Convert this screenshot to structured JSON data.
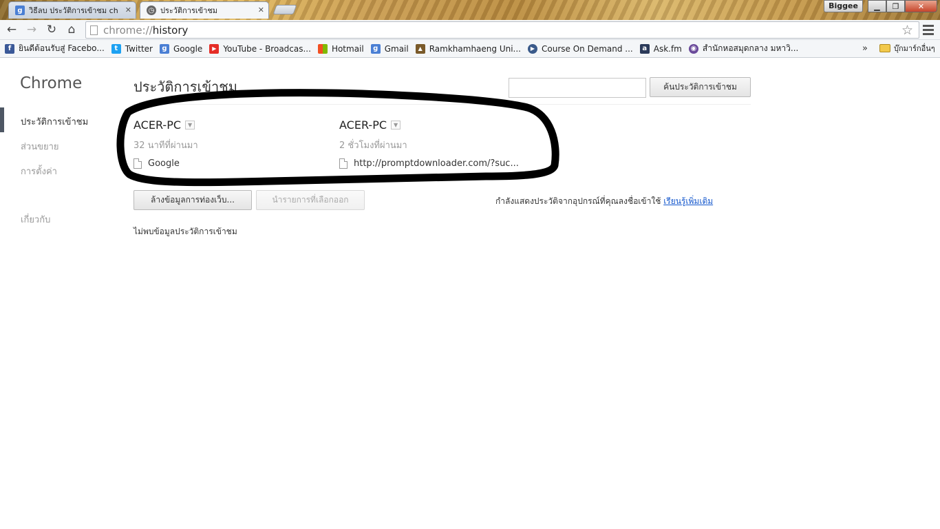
{
  "tabs": [
    {
      "label": "วิธีลบ ประวัติการเข้าชม chrom",
      "icon": "google-search-icon",
      "color": "#4a7fd4"
    },
    {
      "label": "ประวัติการเข้าชม",
      "icon": "history-clock-icon",
      "color": "#555555"
    }
  ],
  "profile_name": "Biggee",
  "toolbar": {
    "url_scheme": "chrome://",
    "url_path": "history"
  },
  "bookmarks": [
    {
      "label": "ยินดีต้อนรับสู่ Facebo...",
      "icon": "facebook-icon",
      "color": "#3b5998",
      "glyph": "f"
    },
    {
      "label": "Twitter",
      "icon": "twitter-icon",
      "color": "#1da1f2",
      "glyph": "t"
    },
    {
      "label": "Google",
      "icon": "google-icon",
      "color": "#4a7fd4",
      "glyph": "g"
    },
    {
      "label": "YouTube - Broadcas...",
      "icon": "youtube-icon",
      "color": "#e52d27",
      "glyph": "▶"
    },
    {
      "label": "Hotmail",
      "icon": "windows-icon",
      "color": "#f25022",
      "glyph": "▦"
    },
    {
      "label": "Gmail",
      "icon": "google-icon",
      "color": "#4a7fd4",
      "glyph": "g"
    },
    {
      "label": "Ramkhamhaeng Uni...",
      "icon": "university-icon",
      "color": "#7a5a2a",
      "glyph": "▲"
    },
    {
      "label": "Course On Demand ...",
      "icon": "play-circle-icon",
      "color": "#3a5a8a",
      "glyph": "●"
    },
    {
      "label": "Ask.fm",
      "icon": "askfm-icon",
      "color": "#2b3a5a",
      "glyph": "a"
    },
    {
      "label": "สำนักหอสมุดกลาง มหาวิ...",
      "icon": "library-seal-icon",
      "color": "#6a4a9a",
      "glyph": "◉"
    }
  ],
  "bookmarks_overflow": "»",
  "other_bookmarks": "บุ๊กมาร์กอื่นๆ",
  "sidebar": {
    "title": "Chrome",
    "items": [
      {
        "label": "ประวัติการเข้าชม"
      },
      {
        "label": "ส่วนขยาย"
      },
      {
        "label": "การตั้งค่า"
      },
      {
        "label": "เกี่ยวกับ"
      }
    ]
  },
  "main": {
    "title": "ประวัติการเข้าชม",
    "search_button": "ค้นประวัติการเข้าชม",
    "search_placeholder": "",
    "devices": [
      {
        "name": "ACER-PC",
        "time": "32 นาทีที่ผ่านมา",
        "entry": "Google"
      },
      {
        "name": "ACER-PC",
        "time": "2 ชั่วโมงที่ผ่านมา",
        "entry": "http://promptdownloader.com/?suc..."
      }
    ],
    "clear_button": "ล้างข้อมูลการท่องเว็บ...",
    "remove_button": "นำรายการที่เลือกออก",
    "info_text": "กำลังแสดงประวัติจากอุปกรณ์ที่คุณลงชื่อเข้าใช้",
    "learn_more": "เรียนรู้เพิ่มเติม",
    "no_history": "ไม่พบข้อมูลประวัติการเข้าชม"
  }
}
